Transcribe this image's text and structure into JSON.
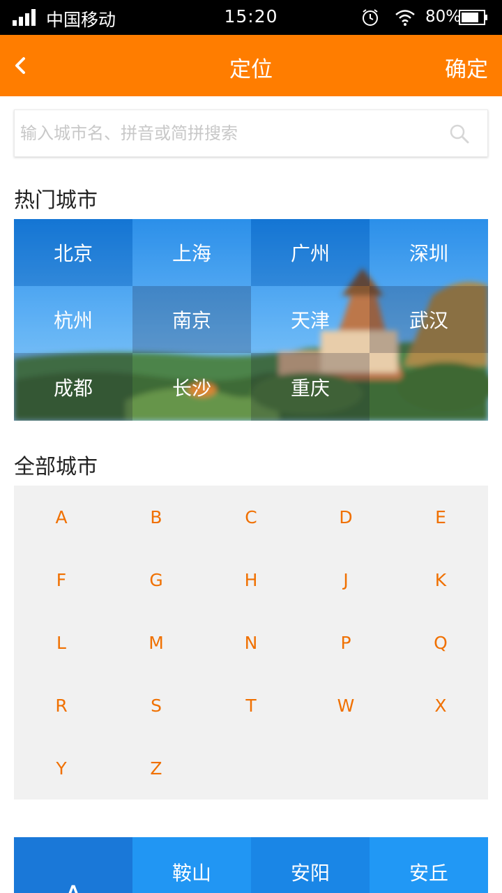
{
  "status_bar": {
    "carrier": "中国移动",
    "time": "15:20",
    "battery": "80%",
    "battery_level": 0.8,
    "icons": [
      "signal-icon",
      "alarm-icon",
      "wifi-icon",
      "battery-icon"
    ]
  },
  "header": {
    "back_icon": "chevron-left-icon",
    "title": "定位",
    "confirm_label": "确定",
    "background": "#ff7d00"
  },
  "search": {
    "placeholder": "输入城市名、拼音或简拼搜索",
    "value": "",
    "icon": "search-icon"
  },
  "hot_cities": {
    "title": "热门城市",
    "cities": [
      "北京",
      "上海",
      "广州",
      "深圳",
      "杭州",
      "南京",
      "天津",
      "武汉",
      "成都",
      "长沙",
      "重庆"
    ]
  },
  "all_cities": {
    "title": "全部城市",
    "letters": [
      "A",
      "B",
      "C",
      "D",
      "E",
      "F",
      "G",
      "H",
      "J",
      "K",
      "L",
      "M",
      "N",
      "P",
      "Q",
      "R",
      "S",
      "T",
      "W",
      "X",
      "Y",
      "Z"
    ],
    "letter_color": "#f07000"
  },
  "city_list_partial": {
    "section_letter": "A",
    "cities": [
      "鞍山",
      "安阳",
      "安丘"
    ]
  }
}
